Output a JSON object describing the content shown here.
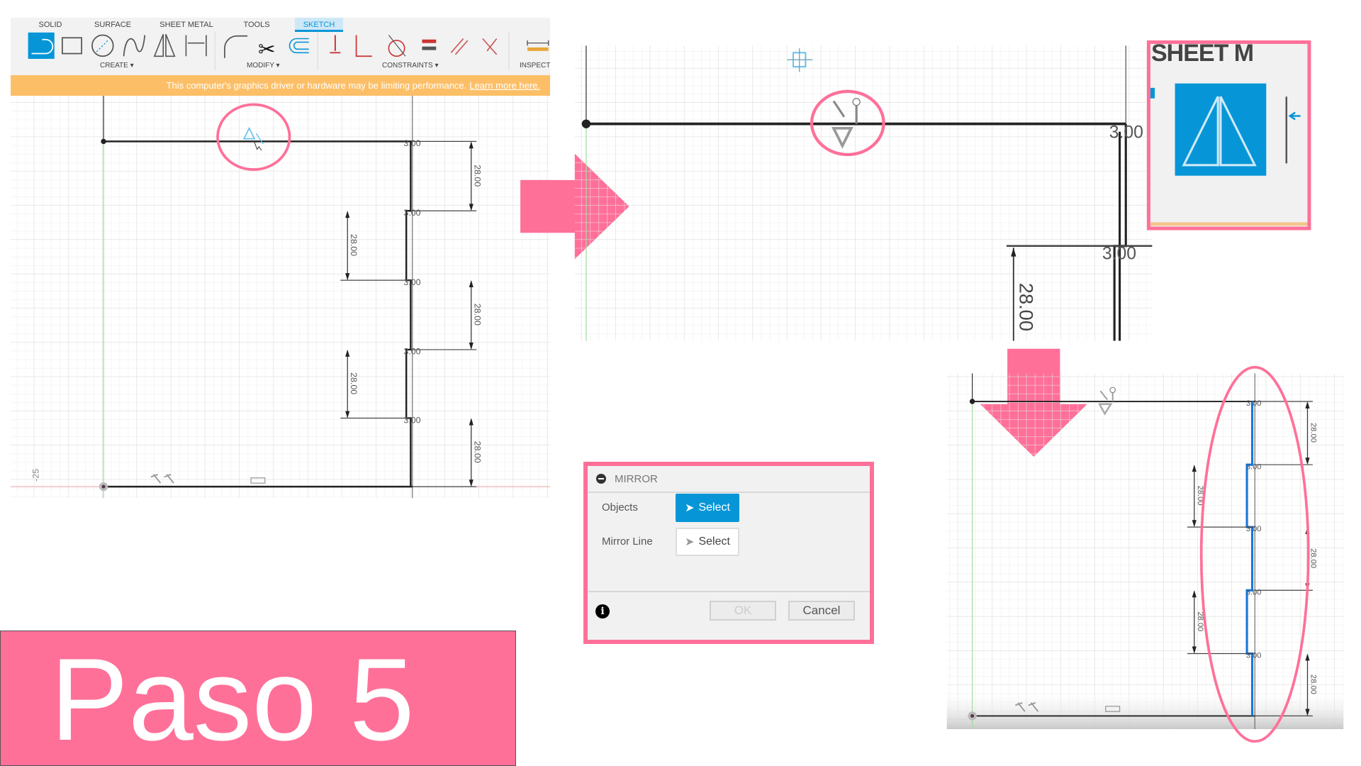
{
  "toolbar": {
    "tabs": [
      "SOLID",
      "SURFACE",
      "SHEET METAL",
      "TOOLS",
      "SKETCH"
    ],
    "active_tab": "SKETCH",
    "groups": [
      "CREATE ▾",
      "MODIFY ▾",
      "CONSTRAINTS ▾",
      "INSPECT"
    ],
    "tools": [
      "line-icon",
      "rectangle-icon",
      "circle-icon",
      "spline-icon",
      "mirror-icon",
      "dimension-icon",
      "fillet-icon",
      "trim-icon",
      "offset-icon",
      "fix-icon",
      "coincident-icon",
      "tangent-icon",
      "equal-icon",
      "parallel-icon",
      "perpendicular-icon",
      "measure-icon"
    ]
  },
  "banner": {
    "message": "This computer's graphics driver or hardware may be limiting performance.",
    "link": "Learn more here."
  },
  "sketch": {
    "step_dimension": "3.00",
    "height_dimension": "28.00",
    "axis_label": "-25"
  },
  "inset": {
    "tab_label": "SHEET M"
  },
  "mirror_dialog": {
    "title": "MIRROR",
    "objects_label": "Objects",
    "objects_button": "Select",
    "mirror_line_label": "Mirror Line",
    "mirror_line_button": "Select",
    "ok": "OK",
    "cancel": "Cancel"
  },
  "step_title": "Paso 5",
  "colors": {
    "highlight_pink": "#ff7099",
    "accent_blue": "#0696d7",
    "mirrored_profile_blue": "#1577e0",
    "warning_banner": "#fcbf67"
  }
}
